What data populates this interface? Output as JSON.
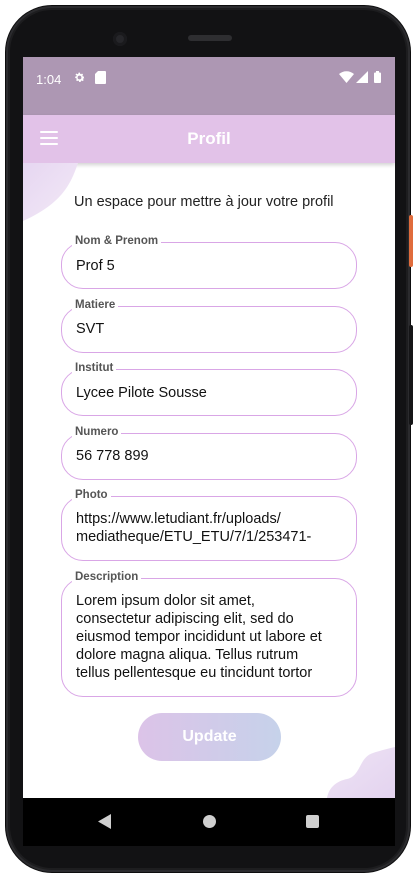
{
  "status": {
    "time": "1:04"
  },
  "appbar": {
    "title": "Profil"
  },
  "intro": {
    "text": "Un espace pour mettre à jour votre profil"
  },
  "form": {
    "fields": [
      {
        "label": "Nom & Prenom",
        "value": "Prof 5"
      },
      {
        "label": "Matiere",
        "value": "SVT"
      },
      {
        "label": "Institut",
        "value": "Lycee Pilote Sousse"
      },
      {
        "label": "Numero",
        "value": "56 778 899"
      },
      {
        "label": "Photo",
        "value": "https://www.letudiant.fr/uploads/\nmediatheque/ETU_ETU/7/1/253471-"
      },
      {
        "label": "Description",
        "value": "Lorem ipsum dolor sit amet,\nconsectetur adipiscing elit, sed do\neiusmod tempor incididunt ut labore et\ndolore magna aliqua. Tellus rutrum\ntellus pellentesque eu tincidunt tortor"
      }
    ]
  },
  "actions": {
    "update_label": "Update"
  },
  "colors": {
    "statusbar": "#ad97b3",
    "appbar": "#e2c2e8",
    "field_border": "#d9a6e6",
    "button_gradient_start": "#dcc3e8",
    "button_gradient_end": "#c6d2ea"
  },
  "icons": {
    "status_left": [
      "gear-icon",
      "sim-card-icon"
    ],
    "status_right": [
      "wifi-icon",
      "signal-icon",
      "battery-icon"
    ],
    "appbar": "menu-icon",
    "nav": [
      "back-icon",
      "home-icon",
      "recents-icon"
    ]
  }
}
